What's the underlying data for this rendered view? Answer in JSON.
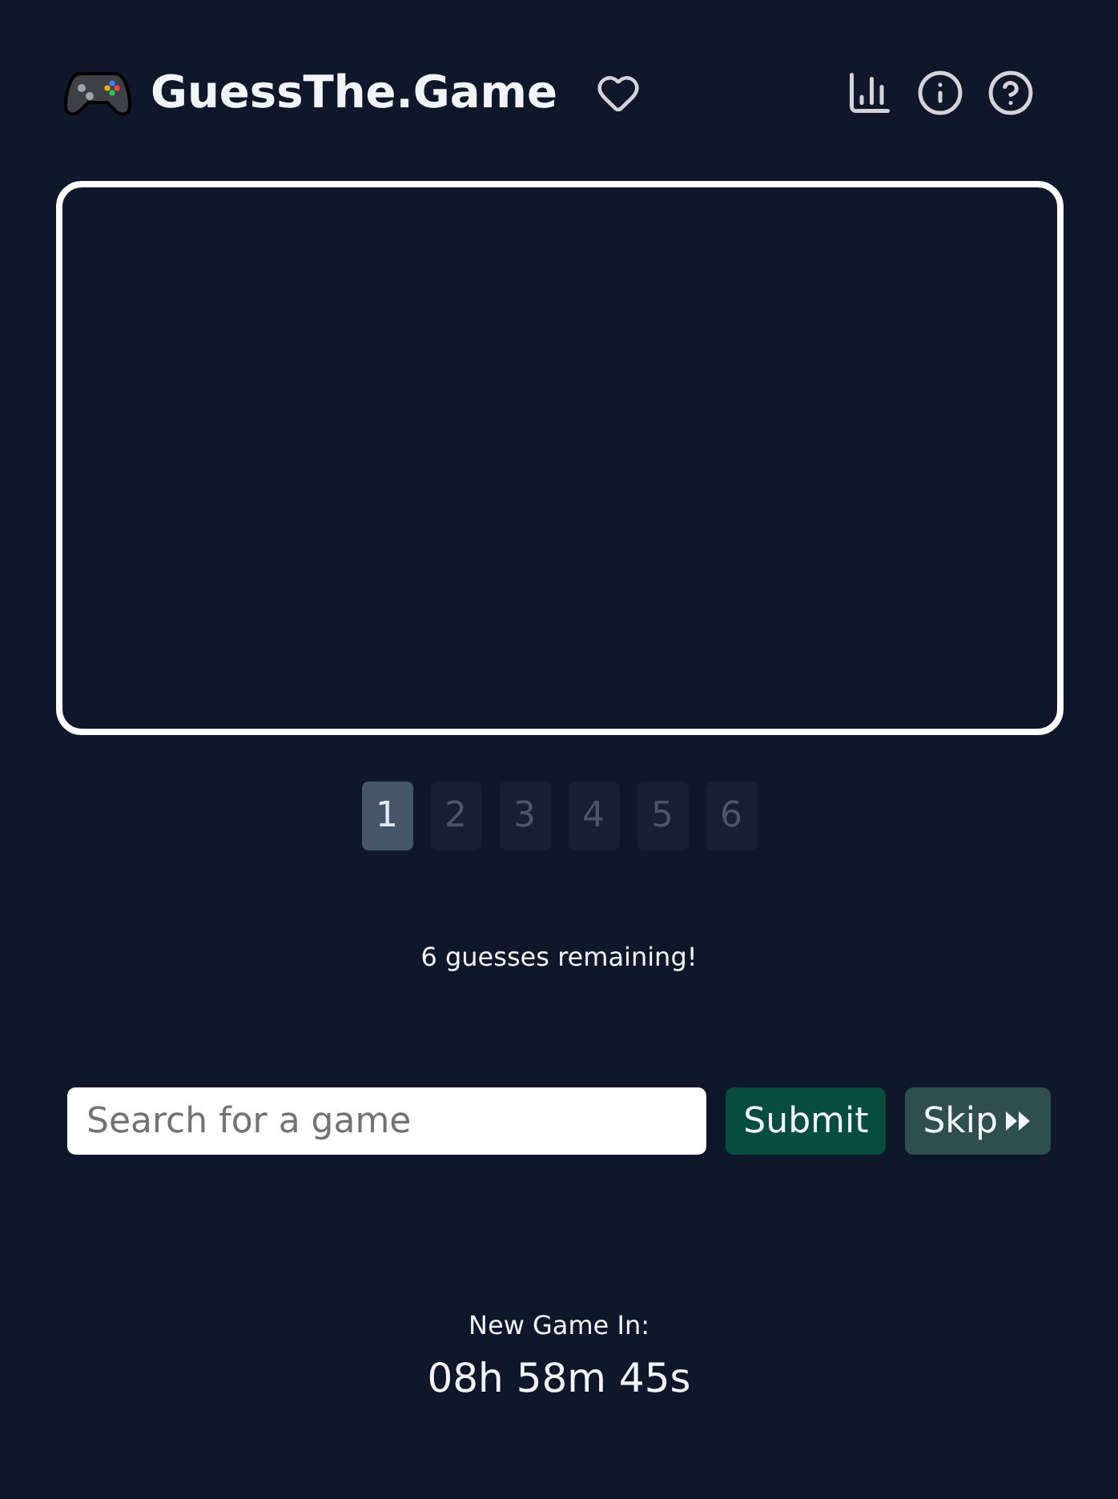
{
  "header": {
    "title": "GuessThe.Game"
  },
  "guess_tabs": [
    {
      "label": "1",
      "selected": true
    },
    {
      "label": "2",
      "selected": false
    },
    {
      "label": "3",
      "selected": false
    },
    {
      "label": "4",
      "selected": false
    },
    {
      "label": "5",
      "selected": false
    },
    {
      "label": "6",
      "selected": false
    }
  ],
  "status": "6 guesses remaining!",
  "search": {
    "placeholder": "Search for a game"
  },
  "submit_button": "Submit",
  "skip_button": "Skip",
  "countdown": {
    "label": "New Game In:",
    "time": "08h 58m 45s"
  }
}
